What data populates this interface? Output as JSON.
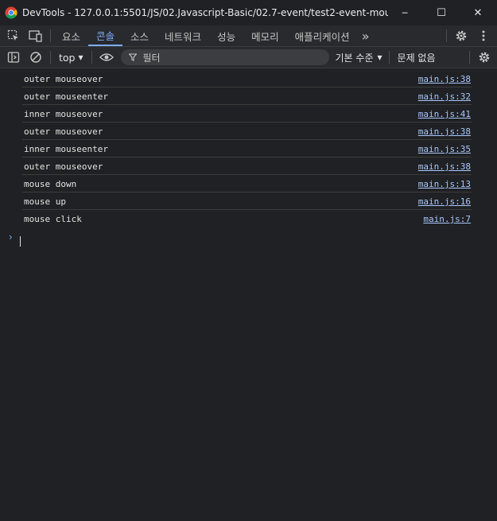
{
  "window": {
    "title": "DevTools - 127.0.0.1:5501/JS/02.Javascript-Basic/02.7-event/test2-event-mouse/ind...",
    "minimize_glyph": "─",
    "maximize_glyph": "☐",
    "close_glyph": "✕"
  },
  "tabs": [
    {
      "label": "요소",
      "active": false
    },
    {
      "label": "콘솔",
      "active": true
    },
    {
      "label": "소스",
      "active": false
    },
    {
      "label": "네트워크",
      "active": false
    },
    {
      "label": "성능",
      "active": false
    },
    {
      "label": "메모리",
      "active": false
    },
    {
      "label": "애플리케이션",
      "active": false
    }
  ],
  "tabbar": {
    "overflow_glyph": "»",
    "icons": [
      "inspect-element-icon",
      "device-toolbar-icon",
      "settings-icon",
      "more-vertical-icon"
    ]
  },
  "toolbar": {
    "context": "top",
    "filter_placeholder": "필터",
    "log_level": "기본 수준",
    "issues": "문제 없음",
    "dropdown_glyph": "▾"
  },
  "console": {
    "rows": [
      {
        "message": "outer mouseover",
        "source": "main.js:38"
      },
      {
        "message": "outer mouseenter",
        "source": "main.js:32"
      },
      {
        "message": "inner mouseover",
        "source": "main.js:41"
      },
      {
        "message": "outer mouseover",
        "source": "main.js:38"
      },
      {
        "message": "inner mouseenter",
        "source": "main.js:35"
      },
      {
        "message": "outer mouseover",
        "source": "main.js:38"
      },
      {
        "message": "mouse down",
        "source": "main.js:13"
      },
      {
        "message": "mouse up",
        "source": "main.js:16"
      },
      {
        "message": "mouse click",
        "source": "main.js:7"
      }
    ],
    "prompt_glyph": "›"
  },
  "colors": {
    "background": "#202124",
    "accent": "#7cacf8",
    "link": "#a8c7fa"
  }
}
